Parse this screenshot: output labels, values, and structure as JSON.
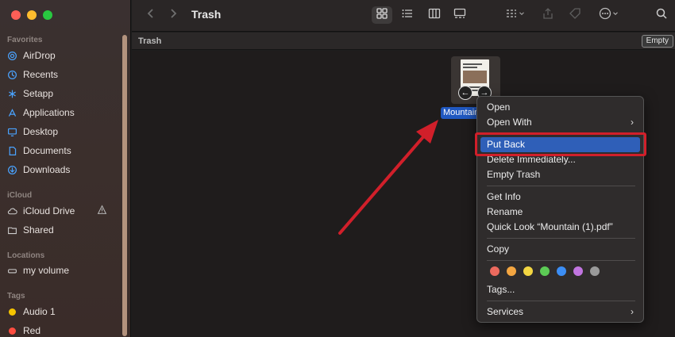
{
  "window": {
    "title": "Trash"
  },
  "sidebar": {
    "sections": [
      {
        "title": "Favorites",
        "items": [
          {
            "label": "AirDrop",
            "icon": "airdrop-icon"
          },
          {
            "label": "Recents",
            "icon": "clock-icon"
          },
          {
            "label": "Setapp",
            "icon": "setapp-icon"
          },
          {
            "label": "Applications",
            "icon": "applications-icon"
          },
          {
            "label": "Desktop",
            "icon": "desktop-icon"
          },
          {
            "label": "Documents",
            "icon": "document-icon"
          },
          {
            "label": "Downloads",
            "icon": "downloads-icon"
          }
        ]
      },
      {
        "title": "iCloud",
        "items": [
          {
            "label": "iCloud Drive",
            "icon": "cloud-icon",
            "badge": "warning-icon"
          },
          {
            "label": "Shared",
            "icon": "shared-folder-icon"
          }
        ]
      },
      {
        "title": "Locations",
        "items": [
          {
            "label": "my volume",
            "icon": "drive-icon"
          }
        ]
      },
      {
        "title": "Tags",
        "items": [
          {
            "label": "Audio 1",
            "color": "#f5c400"
          },
          {
            "label": "Red",
            "color": "#ff4d40"
          }
        ]
      }
    ]
  },
  "pathbar": {
    "label": "Trash",
    "empty_button": "Empty"
  },
  "file": {
    "name": "Mountain"
  },
  "context_menu": {
    "items": [
      {
        "label": "Open"
      },
      {
        "label": "Open With",
        "submenu": true
      },
      {
        "label": "Put Back",
        "highlighted": true
      },
      {
        "label": "Delete Immediately..."
      },
      {
        "label": "Empty Trash"
      },
      {
        "label": "Get Info"
      },
      {
        "label": "Rename"
      },
      {
        "label": "Quick Look “Mountain (1).pdf”"
      },
      {
        "label": "Copy"
      },
      {
        "label": "Tags..."
      },
      {
        "label": "Services",
        "submenu": true
      }
    ],
    "tag_colors": [
      "#ec6a5e",
      "#f4a641",
      "#f3d642",
      "#5ccb55",
      "#3c8ef5",
      "#c175e0",
      "#9a9a9a"
    ]
  },
  "colors": {
    "accent": "#2f5fb8",
    "annotation": "#d11f2a"
  }
}
